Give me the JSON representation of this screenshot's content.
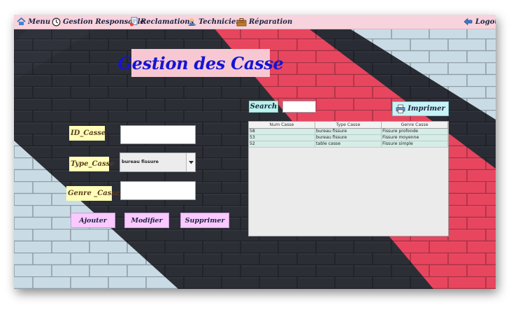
{
  "menubar": {
    "menu": {
      "label": "Menu",
      "icon": "home-icon"
    },
    "responsable": {
      "label": "Gestion Responsable",
      "icon": "clock-icon"
    },
    "reclamations": {
      "label": "Reclamations",
      "icon": "document-icon"
    },
    "techniciens": {
      "label": "Techniciens",
      "icon": "technician-icon"
    },
    "reparation": {
      "label": "Réparation",
      "icon": "toolbox-icon"
    },
    "logout": {
      "label": "Logout",
      "icon": "logout-arrow-icon"
    }
  },
  "title": "Gestion des Casse",
  "form": {
    "id_label": "ID_Casse",
    "id_value": "",
    "type_label": "Type_Casse",
    "type_selected": "bureau fissure",
    "genre_label": "Genre _Casse",
    "genre_value": ""
  },
  "buttons": {
    "add": "Ajouter",
    "modify": "Modifier",
    "delete": "Supprimer"
  },
  "search": {
    "label": "Search",
    "value": ""
  },
  "print": {
    "label": "Imprimer",
    "icon": "printer-icon"
  },
  "table": {
    "columns": [
      "Num Casse",
      "Type Casse",
      "Genre Casse"
    ],
    "rows": [
      [
        "58",
        "bureau fissure",
        "Fissure profonde"
      ],
      [
        "53",
        "bureau fissure",
        "Fissure moyenne"
      ],
      [
        "52",
        "table casse",
        "Fissure simple"
      ]
    ]
  },
  "colors": {
    "menubar": "#f7d3dd",
    "title_text": "#1414d4",
    "title_bg": "#f7c8d2",
    "label_bg": "#ffffb8",
    "button_bg": "#f9c9ff",
    "search_bg": "#b9f4ec",
    "print_bg": "#c6f3f6",
    "table_row": "#d6ece6"
  }
}
